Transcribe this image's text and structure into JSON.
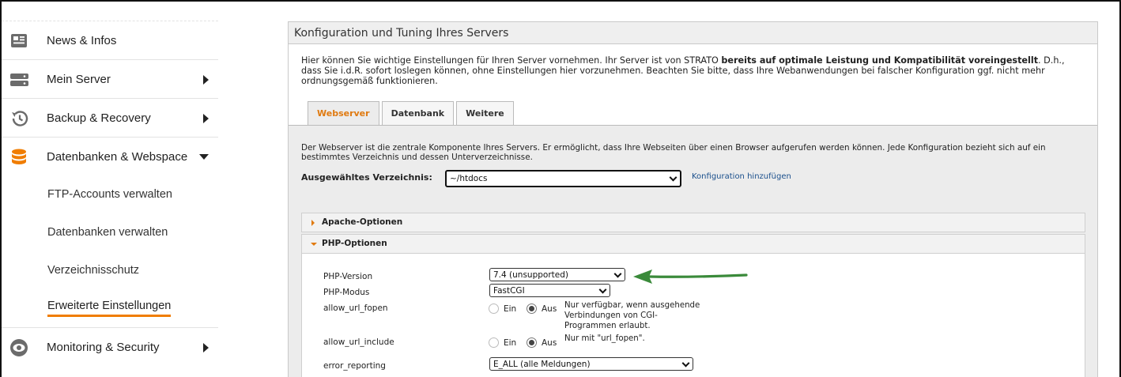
{
  "sidebar": {
    "items": [
      {
        "label": "News & Infos",
        "icon": "news-icon"
      },
      {
        "label": "Mein Server",
        "icon": "server-icon"
      },
      {
        "label": "Backup & Recovery",
        "icon": "history-icon"
      },
      {
        "label": "Datenbanken & Webspace",
        "icon": "database-icon"
      },
      {
        "label": "Monitoring & Security",
        "icon": "eye-icon"
      }
    ],
    "subitems": [
      {
        "label": "FTP-Accounts verwalten"
      },
      {
        "label": "Datenbanken verwalten"
      },
      {
        "label": "Verzeichnisschutz"
      },
      {
        "label": "Erweiterte Einstellungen"
      }
    ]
  },
  "panel": {
    "title": "Konfiguration und Tuning Ihres Servers",
    "intro_pre": "Hier können Sie wichtige Einstellungen für Ihren Server vornehmen. Ihr Server ist von STRATO ",
    "intro_bold": "bereits auf optimale Leistung und Kompatibilität voreingestellt",
    "intro_post": ". D.h., dass Sie i.d.R. sofort loslegen können, ohne Einstellungen hier vorzunehmen. Beachten Sie bitte, dass Ihre Webanwendungen bei falscher Konfiguration ggf. nicht mehr ordnungsgemäß funktionieren.",
    "tabs": [
      {
        "label": "Webserver"
      },
      {
        "label": "Datenbank"
      },
      {
        "label": "Weitere"
      }
    ],
    "description": "Der Webserver ist die zentrale Komponente Ihres Servers. Er ermöglicht, dass Ihre Webseiten über einen Browser aufgerufen werden können. Jede Konfiguration bezieht sich auf ein bestimmtes Verzeichnis und dessen Unterverzeichnisse.",
    "dir_label": "Ausgewähltes Verzeichnis:",
    "dir_value": "~/htdocs",
    "add_config": "Konfiguration hinzufügen",
    "apache_title": "Apache-Optionen",
    "php_title": "PHP-Optionen",
    "php": {
      "version_label": "PHP-Version",
      "version_value": "7.4 (unsupported)",
      "mode_label": "PHP-Modus",
      "mode_value": "FastCGI",
      "fopen_label": "allow_url_fopen",
      "include_label": "allow_url_include",
      "opt_on": "Ein",
      "opt_off": "Aus",
      "fopen_note": "Nur verfügbar, wenn ausgehende Verbindungen von CGI-Programmen erlaubt.",
      "include_note": "Nur mit \"url_fopen\".",
      "error_label": "error_reporting",
      "error_value": "E_ALL (alle Meldungen)"
    }
  },
  "colors": {
    "accent": "#f07d00",
    "arrow": "#3a8a3a",
    "link": "#1a4f8c"
  }
}
